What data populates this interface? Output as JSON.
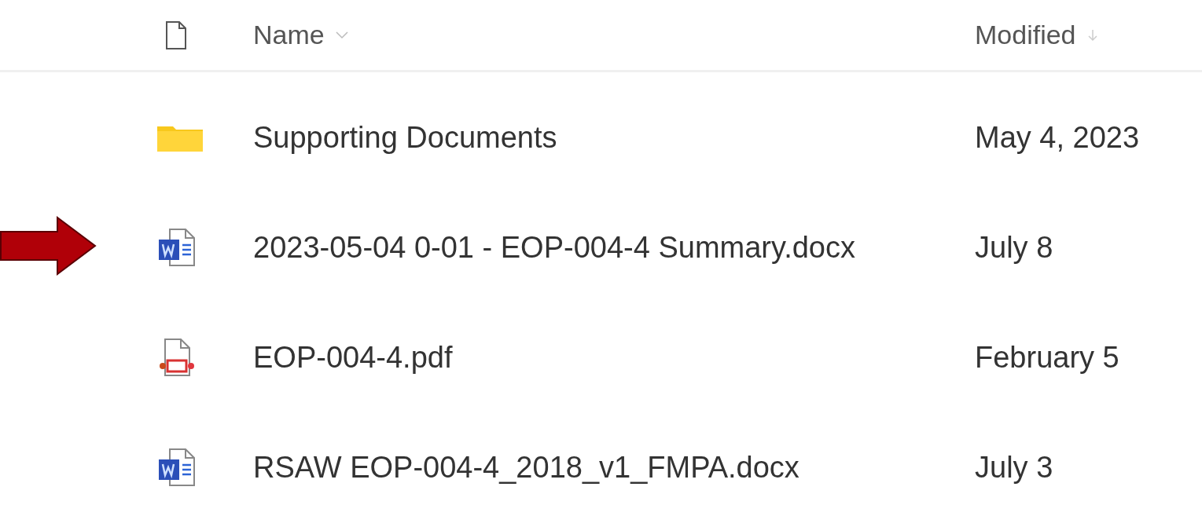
{
  "columns": [
    {
      "label": "Name",
      "kind": "chevron"
    },
    {
      "label": "Modified",
      "kind": "arrow"
    }
  ],
  "rows": [
    {
      "kind": "folder",
      "name": "Supporting Documents",
      "modified": "May 4, 2023",
      "marked": false
    },
    {
      "kind": "word",
      "name": "2023-05-04 0-01 - EOP-004-4 Summary.docx",
      "modified": "July 8",
      "marked": true
    },
    {
      "kind": "pdf",
      "name": "EOP-004-4.pdf",
      "modified": "February 5",
      "marked": false
    },
    {
      "kind": "word",
      "name": "RSAW EOP-004-4_2018_v1_FMPA.docx",
      "modified": "July 3",
      "marked": false
    }
  ]
}
